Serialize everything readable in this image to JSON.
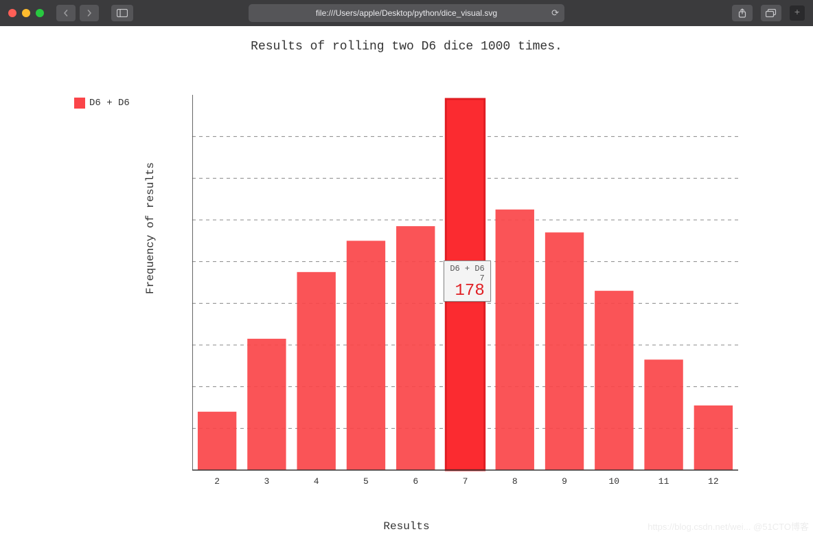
{
  "browser": {
    "url": "file:///Users/apple/Desktop/python/dice_visual.svg"
  },
  "chart_data": {
    "type": "bar",
    "title": "Results of rolling two D6 dice 1000 times.",
    "xlabel": "Results",
    "ylabel": "Frequency of results",
    "categories": [
      2,
      3,
      4,
      5,
      6,
      7,
      8,
      9,
      10,
      11,
      12
    ],
    "series": [
      {
        "name": "D6 + D6",
        "values": [
          28,
          63,
          95,
          110,
          117,
          178,
          125,
          114,
          86,
          53,
          31
        ]
      }
    ],
    "ylim": [
      0,
      180
    ],
    "yticks": [
      0,
      20,
      40,
      60,
      80,
      100,
      120,
      140,
      160
    ],
    "highlight": {
      "category": 7,
      "value": 178,
      "series": "D6 + D6"
    }
  },
  "tooltip": {
    "series_label": "D6 + D6",
    "category_label": "7",
    "value_label": "178"
  },
  "watermark": "https://blog.csdn.net/wei... @51CTO博客"
}
